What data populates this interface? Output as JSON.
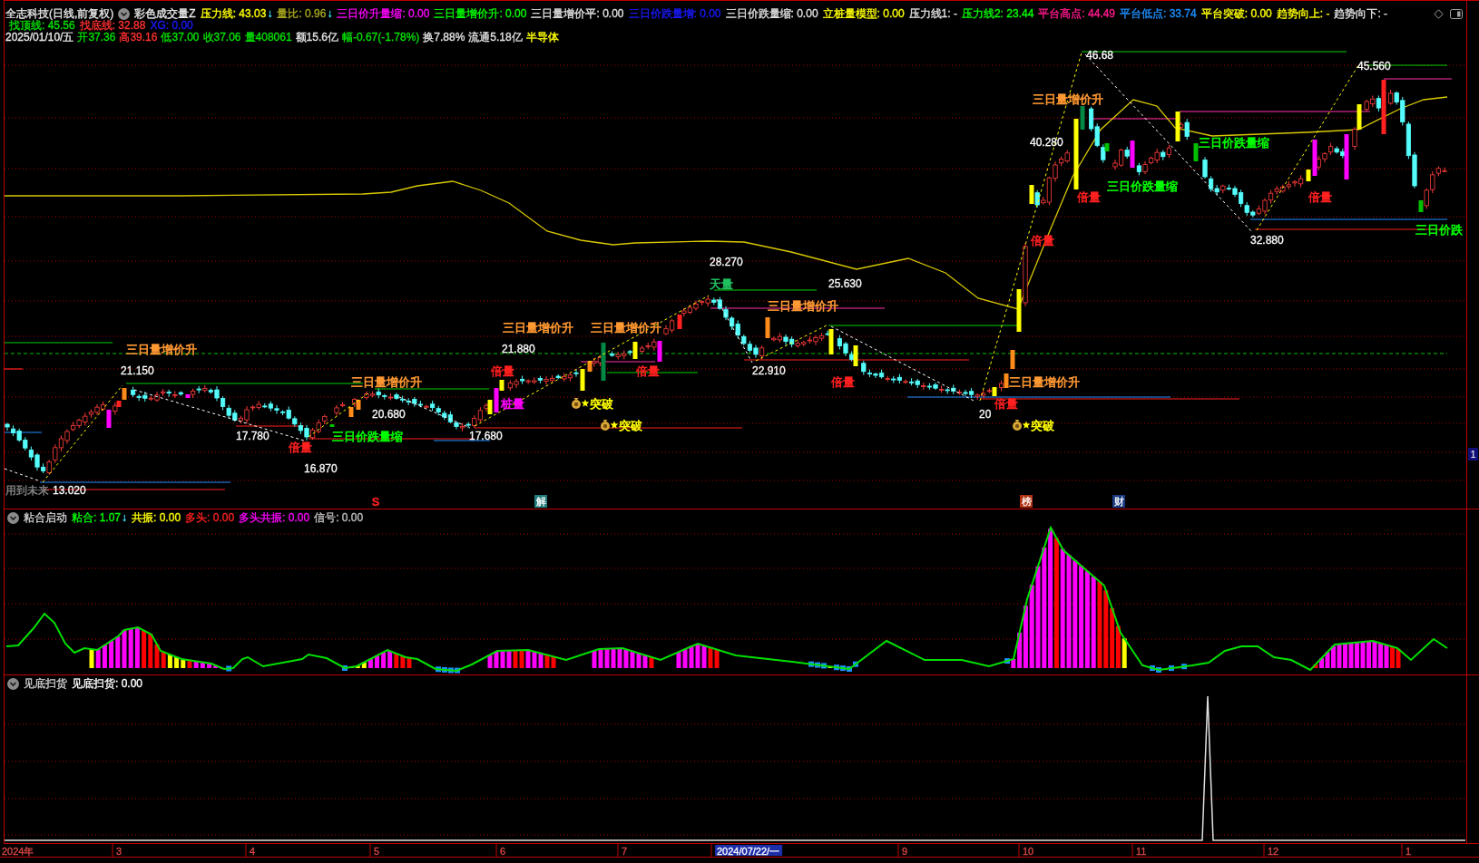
{
  "header": {
    "title": "全志科技(日线,前复权)",
    "indicator": "彩色成交量Z",
    "values": [
      {
        "text": "压力线: 43.03",
        "color": "#ffff00",
        "arrow": "↓"
      },
      {
        "text": "量比: 0.96",
        "color": "#a8a820",
        "arrow": "↓"
      },
      {
        "text": "三日价升量缩: 0.00",
        "color": "#ff00ff"
      },
      {
        "text": "三日量增价升: 0.00",
        "color": "#00ff00"
      },
      {
        "text": "三日量增价平: 0.00",
        "color": "#e0e0e0"
      },
      {
        "text": "三日价跌量增: 0.00",
        "color": "#1a1aff"
      },
      {
        "text": "三日价跌量缩: 0.00",
        "color": "#e0e0e0"
      },
      {
        "text": "立桩量模型: 0.00",
        "color": "#ffff00"
      },
      {
        "text": "压力线1: -",
        "color": "#e0e0e0"
      },
      {
        "text": "压力线2: 23.44",
        "color": "#00ff00"
      },
      {
        "text": "平台高点: 44.49",
        "color": "#ff1a8c"
      },
      {
        "text": "平台低点: 33.74",
        "color": "#1e90ff"
      },
      {
        "text": "平台突破: 0.00",
        "color": "#ffff00"
      },
      {
        "text": "趋势向上: -",
        "color": "#ffff00"
      },
      {
        "text": "趋势向下: -",
        "color": "#e0e0e0"
      }
    ],
    "values_2": [
      {
        "text": "找顶线: 45.56",
        "color": "#00e000"
      },
      {
        "text": "找底线: 32.88",
        "color": "#ff3030"
      },
      {
        "text": "XG: 0.00",
        "color": "#1a1aff"
      }
    ]
  },
  "quote": {
    "date": "2025/01/10/五",
    "fields": [
      {
        "text": "开37.36",
        "color": "#00e000"
      },
      {
        "text": "高39.16",
        "color": "#ff3030"
      },
      {
        "text": "低37.00",
        "color": "#00e000"
      },
      {
        "text": "收37.06",
        "color": "#00e000"
      },
      {
        "text": "量408061",
        "color": "#00e000"
      },
      {
        "text": "额15.6亿",
        "color": "#e0e0e0"
      },
      {
        "text": "幅-0.67(-1.78%)",
        "color": "#00e000"
      },
      {
        "text": "换7.88%",
        "color": "#e0e0e0"
      },
      {
        "text": "流通5.18亿",
        "color": "#e0e0e0"
      },
      {
        "text": "半导体",
        "color": "#ffff00"
      }
    ]
  },
  "main_chart": {
    "annotations": [
      {
        "text": "46.68",
        "kind": "price",
        "color": "#ffffff"
      },
      {
        "text": "45.560",
        "kind": "price",
        "color": "#ffffff"
      },
      {
        "text": "三日量增价升",
        "kind": "pattern",
        "color": "#ff9933"
      },
      {
        "text": "40.280",
        "kind": "price",
        "color": "#ffffff"
      },
      {
        "text": "三日价跌量缩",
        "kind": "pattern",
        "color": "#00ff00"
      },
      {
        "text": "三日价跌量缩",
        "kind": "pattern",
        "color": "#00ff00"
      },
      {
        "text": "倍量",
        "kind": "pattern",
        "color": "#ff2020"
      },
      {
        "text": "倍量",
        "kind": "pattern",
        "color": "#ff2020"
      },
      {
        "text": "三日价跌",
        "kind": "pattern",
        "color": "#00ff00"
      },
      {
        "text": "倍量",
        "kind": "pattern",
        "color": "#ff2020"
      },
      {
        "text": "32.880",
        "kind": "price",
        "color": "#ffffff"
      },
      {
        "text": "天量",
        "kind": "pattern",
        "color": "#20c060"
      },
      {
        "text": "28.270",
        "kind": "price",
        "color": "#ffffff"
      },
      {
        "text": "三日量增价升",
        "kind": "pattern",
        "color": "#ff9933"
      },
      {
        "text": "25.630",
        "kind": "price",
        "color": "#ffffff"
      },
      {
        "text": "三日量增价升",
        "kind": "pattern",
        "color": "#ff9933"
      },
      {
        "text": "突破",
        "kind": "breakout",
        "color": "#ffff00"
      },
      {
        "text": "三日量增价升",
        "kind": "pattern",
        "color": "#ff9933"
      },
      {
        "text": "倍量",
        "kind": "pattern",
        "color": "#ff2020"
      },
      {
        "text": "倍量",
        "kind": "pattern",
        "color": "#ff2020"
      },
      {
        "text": "22.910",
        "kind": "price",
        "color": "#ffffff"
      },
      {
        "text": "三日量增价升",
        "kind": "pattern",
        "color": "#ff9933"
      },
      {
        "text": "三日量增价升",
        "kind": "pattern",
        "color": "#ff9933"
      },
      {
        "text": "21.880",
        "kind": "price",
        "color": "#ffffff"
      },
      {
        "text": "21.150",
        "kind": "price",
        "color": "#ffffff"
      },
      {
        "text": "20.680",
        "kind": "price",
        "color": "#ffffff"
      },
      {
        "text": "桩量",
        "kind": "pattern",
        "color": "#ff00ff"
      },
      {
        "text": "突破",
        "kind": "breakout",
        "color": "#ffff00"
      },
      {
        "text": "三日量增价升",
        "kind": "pattern",
        "color": "#ff9933"
      },
      {
        "text": "突破",
        "kind": "breakout",
        "color": "#ffff00"
      },
      {
        "text": "20",
        "kind": "price",
        "color": "#ffffff"
      },
      {
        "text": "倍量",
        "kind": "pattern",
        "color": "#ff2020"
      },
      {
        "text": "倍量",
        "kind": "pattern",
        "color": "#ff2020"
      },
      {
        "text": "倍量",
        "kind": "pattern",
        "color": "#ff2020"
      },
      {
        "text": "17.780",
        "kind": "price",
        "color": "#ffffff"
      },
      {
        "text": "三日价跌量缩",
        "kind": "pattern",
        "color": "#00ff00"
      },
      {
        "text": "17.680",
        "kind": "price",
        "color": "#ffffff"
      },
      {
        "text": "16.870",
        "kind": "price",
        "color": "#ffffff"
      },
      {
        "text": "13.020",
        "kind": "price",
        "color": "#ffffff"
      }
    ],
    "note": "用到未来",
    "markers": [
      {
        "text": "S",
        "kind": "sign",
        "color": "#ff2020"
      },
      {
        "text": "解",
        "kind": "badge",
        "color": "#1f7a7a"
      },
      {
        "text": "榜",
        "kind": "badge",
        "color": "#b03010"
      },
      {
        "text": "财",
        "kind": "badge",
        "color": "#1a3a80"
      }
    ]
  },
  "price_axis": {
    "tag": "1"
  },
  "panel_1": {
    "title": "粘合启动",
    "values": [
      {
        "text": "粘合: 1.07",
        "color": "#00ff00",
        "arrow": "↓"
      },
      {
        "text": "共振: 0.00",
        "color": "#ffff00"
      },
      {
        "text": "多头: 0.00",
        "color": "#ff2020"
      },
      {
        "text": "多头共振: 0.00",
        "color": "#ff00ff"
      },
      {
        "text": "信号: 0.00",
        "color": "#c0c0c0"
      }
    ]
  },
  "panel_2": {
    "title": "见底扫货",
    "values": [
      {
        "text": "见底扫货: 0.00",
        "color": "#ffffff"
      }
    ]
  },
  "time_axis": {
    "labels": [
      {
        "text": "2024年",
        "selected": false
      },
      {
        "text": "3",
        "selected": false
      },
      {
        "text": "4",
        "selected": false
      },
      {
        "text": "5",
        "selected": false
      },
      {
        "text": "6",
        "selected": false
      },
      {
        "text": "7",
        "selected": false
      },
      {
        "text": "2024/07/22/一",
        "selected": true
      },
      {
        "text": "9",
        "selected": false
      },
      {
        "text": "10",
        "selected": false
      },
      {
        "text": "11",
        "selected": false
      },
      {
        "text": "12",
        "selected": false
      },
      {
        "text": "1",
        "selected": false
      }
    ]
  }
}
